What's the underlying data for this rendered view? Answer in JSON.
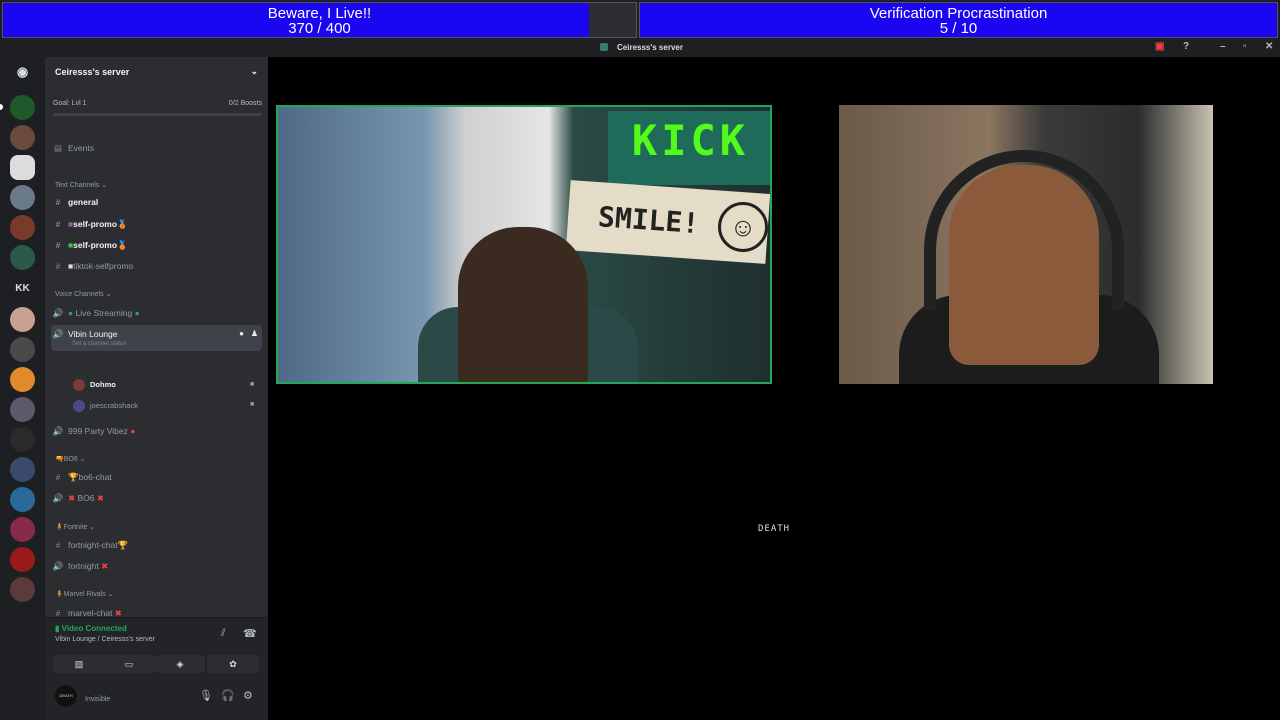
{
  "goals": [
    {
      "title": "Beware, I Live!!",
      "count": "370 / 400",
      "progress": 0.925
    },
    {
      "title": "Verification Procrastination",
      "count": "5 / 10",
      "progress": 1.0
    }
  ],
  "window": {
    "title": "Ceiresss's server"
  },
  "server": {
    "name": "Ceiresss's server",
    "goal": "Goal: Lvl 1",
    "boosts": "0/2 Boosts",
    "events": "Events",
    "categories": {
      "text": "Text Channels",
      "voice": "Voice Channels",
      "bo6": "BO6",
      "fortnite": "Fortnite",
      "marvel": "Marvel Rivals"
    },
    "channels": {
      "general": "general",
      "selfpromo1": "self-promo",
      "selfpromo2": "self-promo",
      "tiktok": "tiktok-selfpromo",
      "live": "Live Streaming",
      "lounge": "Vibin Lounge",
      "lounge_status": "Set a channel status",
      "party": "999 Party Vibez",
      "bo6chat": "bo6-chat",
      "bo6": "BO6",
      "fnchat": "fortnight-chat",
      "fn": "fortnight",
      "marvelchat": "marvel-chat"
    },
    "voice_users": [
      "Dohmo",
      "joescrabshack"
    ]
  },
  "voice_panel": {
    "status": "Video Connected",
    "location": "Vibin Lounge / Ceiresss's server"
  },
  "user_panel": {
    "avatar_text": "DEATH",
    "status": "Invisible"
  },
  "stage": {
    "label": "DEATH",
    "kick": "KICK",
    "smile": "SMILE!"
  },
  "colors": {
    "goal_fill": "#1a06f0",
    "connected": "#23a55a",
    "speaking_border": "#23a55a"
  }
}
